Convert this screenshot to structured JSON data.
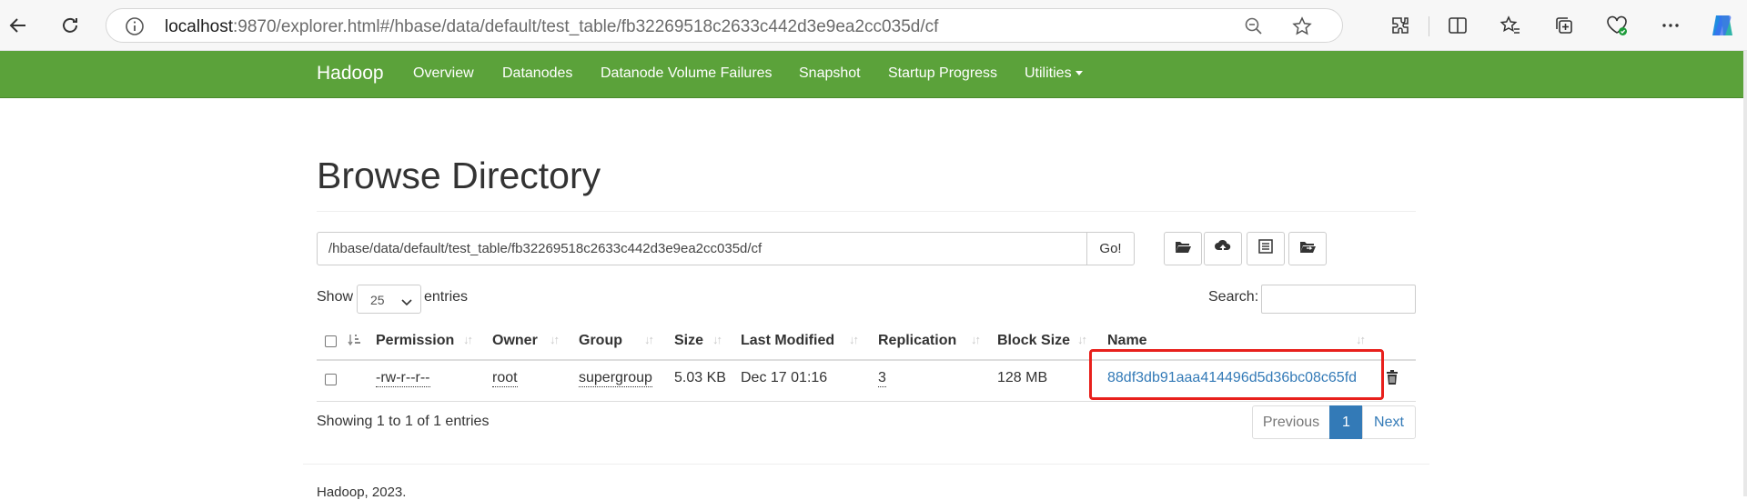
{
  "browser": {
    "url_host": "localhost",
    "url_rest": ":9870/explorer.html#/hbase/data/default/test_table/fb32269518c2633c442d3e9ea2cc035d/cf"
  },
  "navbar": {
    "brand": "Hadoop",
    "links": [
      "Overview",
      "Datanodes",
      "Datanode Volume Failures",
      "Snapshot",
      "Startup Progress",
      "Utilities"
    ]
  },
  "page": {
    "title": "Browse Directory",
    "path": "/hbase/data/default/test_table/fb32269518c2633c442d3e9ea2cc035d/cf",
    "go_label": "Go!",
    "show_label": "Show",
    "show_value": "25",
    "entries_label": "entries",
    "search_label": "Search:"
  },
  "table": {
    "headers": [
      "Permission",
      "Owner",
      "Group",
      "Size",
      "Last Modified",
      "Replication",
      "Block Size",
      "Name"
    ],
    "rows": [
      {
        "permission": "-rw-r--r--",
        "owner": "root",
        "group": "supergroup",
        "size": "5.03 KB",
        "last_modified": "Dec 17 01:16",
        "replication": "3",
        "block_size": "128 MB",
        "name": "88df3db91aaa414496d5d36bc08c65fd"
      }
    ]
  },
  "pagination": {
    "info": "Showing 1 to 1 of 1 entries",
    "previous": "Previous",
    "current": "1",
    "next": "Next"
  },
  "footer": {
    "text": "Hadoop, 2023."
  },
  "colors": {
    "navbar": "#5ba23a",
    "link": "#337ab7",
    "highlight": "#e8201c"
  }
}
